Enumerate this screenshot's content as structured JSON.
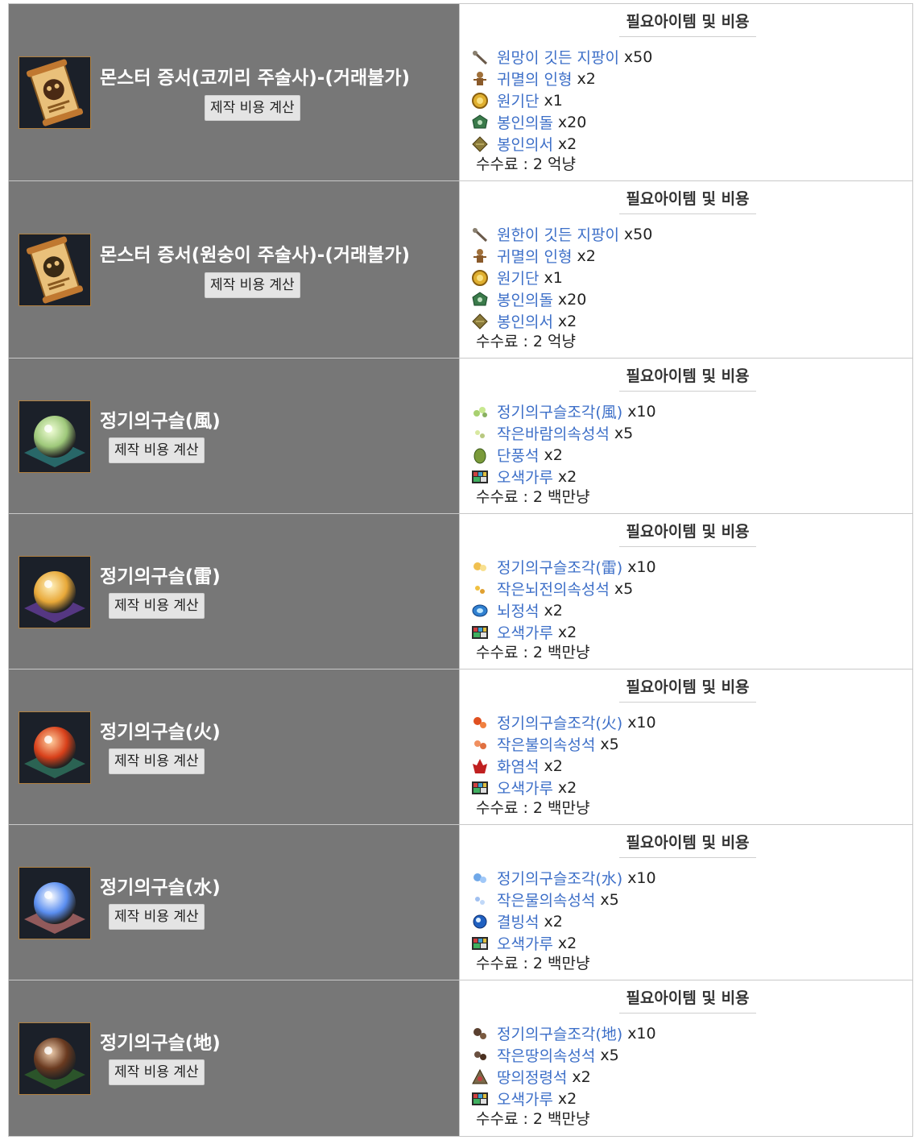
{
  "header_label": "필요아이템 및 비용",
  "calc_label": "제작 비용 계산",
  "fee_prefix": "수수료 : ",
  "recipes": [
    {
      "name": "몬스터 증서(코끼리 주술사)-(거래불가)",
      "icon": "scroll-elephant-icon",
      "fee": "2 억냥",
      "items": [
        {
          "name": "원망이 깃든 지팡이",
          "qty": "x50",
          "icon": "staff-icon"
        },
        {
          "name": "귀멸의 인형",
          "qty": "x2",
          "icon": "doll-icon"
        },
        {
          "name": "원기단",
          "qty": "x1",
          "icon": "gold-orb-icon"
        },
        {
          "name": "봉인의돌",
          "qty": "x20",
          "icon": "seal-stone-icon"
        },
        {
          "name": "봉인의서",
          "qty": "x2",
          "icon": "seal-book-icon"
        }
      ]
    },
    {
      "name": "몬스터 증서(원숭이 주술사)-(거래불가)",
      "icon": "scroll-monkey-icon",
      "fee": "2 억냥",
      "items": [
        {
          "name": "원한이 깃든 지팡이",
          "qty": "x50",
          "icon": "staff-icon"
        },
        {
          "name": "귀멸의 인형",
          "qty": "x2",
          "icon": "doll-icon"
        },
        {
          "name": "원기단",
          "qty": "x1",
          "icon": "gold-orb-icon"
        },
        {
          "name": "봉인의돌",
          "qty": "x20",
          "icon": "seal-stone-icon"
        },
        {
          "name": "봉인의서",
          "qty": "x2",
          "icon": "seal-book-icon"
        }
      ]
    },
    {
      "name": "정기의구슬(風)",
      "icon": "orb-wind-icon",
      "fee": "2 백만냥",
      "items": [
        {
          "name": "정기의구슬조각(風)",
          "qty": "x10",
          "icon": "wind-fragment-icon"
        },
        {
          "name": "작은바람의속성석",
          "qty": "x5",
          "icon": "wind-stone-small-icon"
        },
        {
          "name": "단풍석",
          "qty": "x2",
          "icon": "maple-stone-icon"
        },
        {
          "name": "오색가루",
          "qty": "x2",
          "icon": "five-color-powder-icon"
        }
      ]
    },
    {
      "name": "정기의구슬(雷)",
      "icon": "orb-thunder-icon",
      "fee": "2 백만냥",
      "items": [
        {
          "name": "정기의구슬조각(雷)",
          "qty": "x10",
          "icon": "thunder-fragment-icon"
        },
        {
          "name": "작은뇌전의속성석",
          "qty": "x5",
          "icon": "thunder-stone-small-icon"
        },
        {
          "name": "뇌정석",
          "qty": "x2",
          "icon": "thunder-crystal-icon"
        },
        {
          "name": "오색가루",
          "qty": "x2",
          "icon": "five-color-powder-icon"
        }
      ]
    },
    {
      "name": "정기의구슬(火)",
      "icon": "orb-fire-icon",
      "fee": "2 백만냥",
      "items": [
        {
          "name": "정기의구슬조각(火)",
          "qty": "x10",
          "icon": "fire-fragment-icon"
        },
        {
          "name": "작은불의속성석",
          "qty": "x5",
          "icon": "fire-stone-small-icon"
        },
        {
          "name": "화염석",
          "qty": "x2",
          "icon": "flame-stone-icon"
        },
        {
          "name": "오색가루",
          "qty": "x2",
          "icon": "five-color-powder-icon"
        }
      ]
    },
    {
      "name": "정기의구슬(水)",
      "icon": "orb-water-icon",
      "fee": "2 백만냥",
      "items": [
        {
          "name": "정기의구슬조각(水)",
          "qty": "x10",
          "icon": "water-fragment-icon"
        },
        {
          "name": "작은물의속성석",
          "qty": "x5",
          "icon": "water-stone-small-icon"
        },
        {
          "name": "결빙석",
          "qty": "x2",
          "icon": "ice-stone-icon"
        },
        {
          "name": "오색가루",
          "qty": "x2",
          "icon": "five-color-powder-icon"
        }
      ]
    },
    {
      "name": "정기의구슬(地)",
      "icon": "orb-earth-icon",
      "fee": "2 백만냥",
      "items": [
        {
          "name": "정기의구슬조각(地)",
          "qty": "x10",
          "icon": "earth-fragment-icon"
        },
        {
          "name": "작은땅의속성석",
          "qty": "x5",
          "icon": "earth-stone-small-icon"
        },
        {
          "name": "땅의정령석",
          "qty": "x2",
          "icon": "earth-spirit-stone-icon"
        },
        {
          "name": "오색가루",
          "qty": "x2",
          "icon": "five-color-powder-icon"
        }
      ]
    }
  ]
}
